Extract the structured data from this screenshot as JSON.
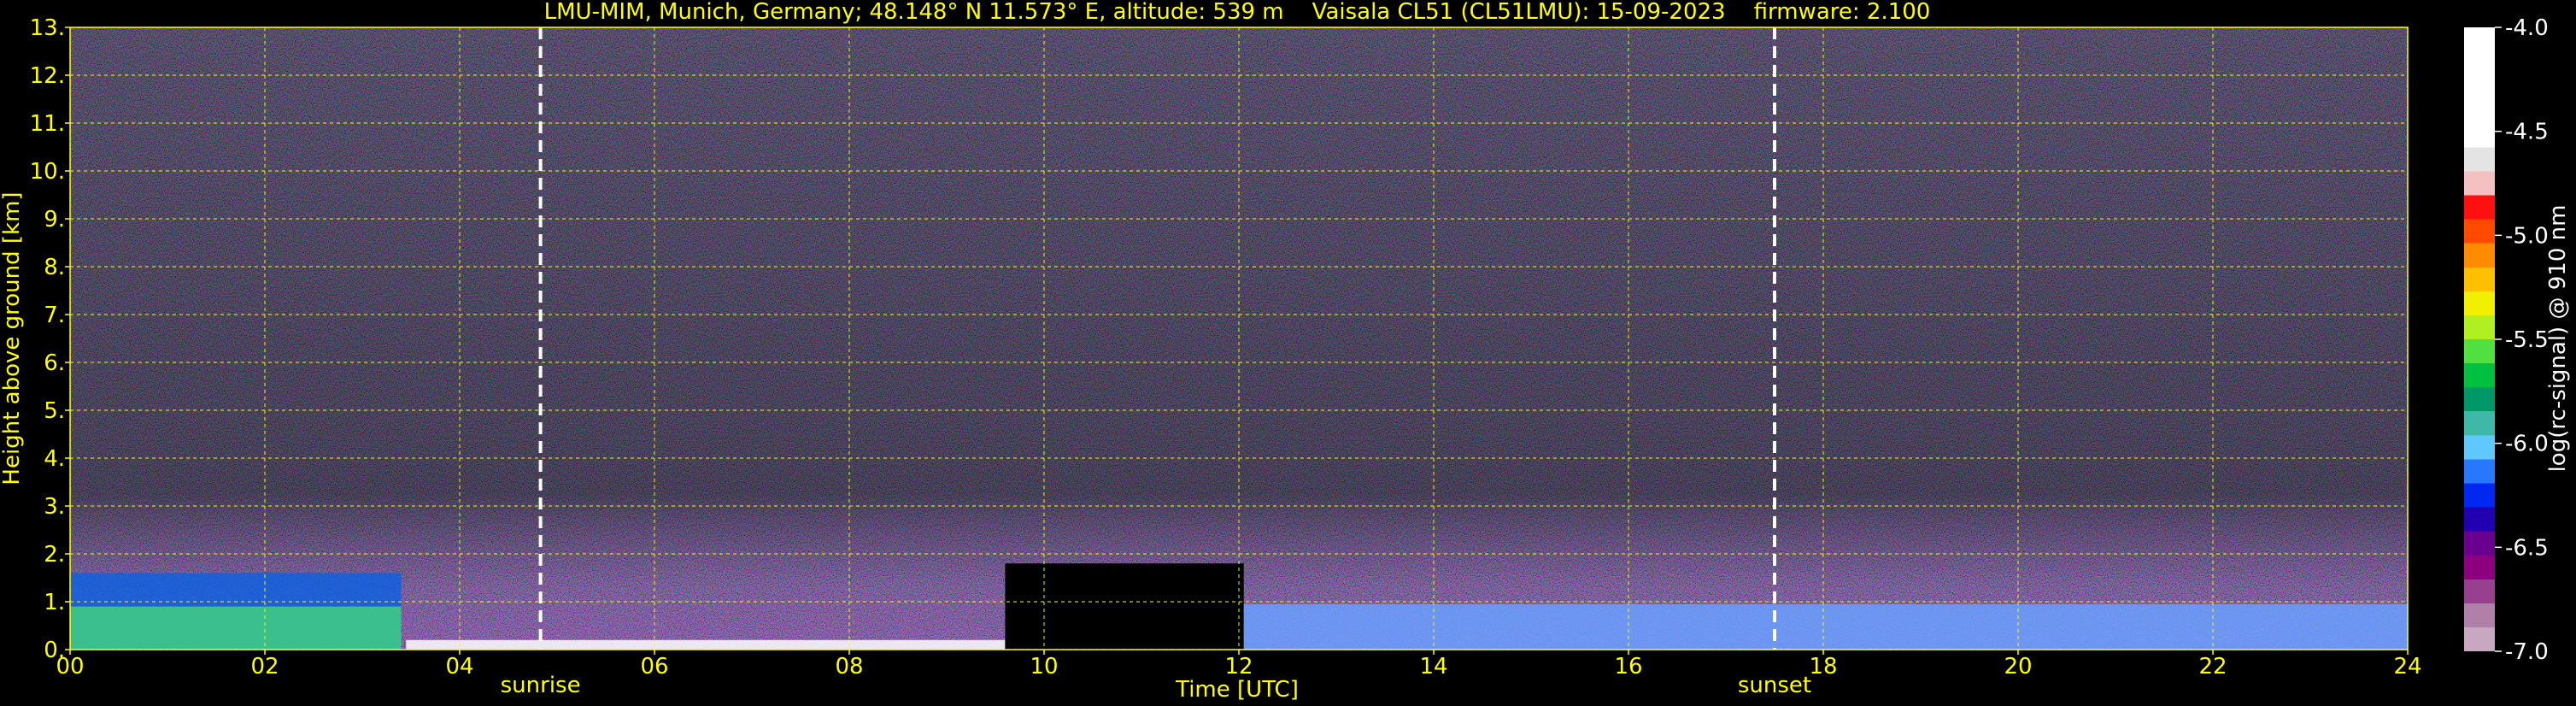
{
  "header": {
    "title": "LMU-MIM, Munich, Germany; 48.148° N 11.573° E, altitude: 539 m    Vaisala CL51 (CL51LMU): 15-09-2023    firmware: 2.100"
  },
  "chart_data": {
    "type": "heatmap",
    "title": "LMU-MIM, Munich, Germany; 48.148° N 11.573° E, altitude: 539 m    Vaisala CL51 (CL51LMU): 15-09-2023    firmware: 2.100",
    "xlabel": "Time [UTC]",
    "ylabel": "Height above ground [km]",
    "xlim": [
      0,
      24
    ],
    "ylim": [
      0,
      13
    ],
    "x_ticks": [
      "00",
      "02",
      "04",
      "06",
      "08",
      "10",
      "12",
      "14",
      "16",
      "18",
      "20",
      "22",
      "24"
    ],
    "x_tick_values": [
      0,
      2,
      4,
      6,
      8,
      10,
      12,
      14,
      16,
      18,
      20,
      22,
      24
    ],
    "y_ticks": [
      "0.",
      "1.",
      "2.",
      "3.",
      "4.",
      "5.",
      "6.",
      "7.",
      "8.",
      "9.",
      "10.",
      "11.",
      "12.",
      "13."
    ],
    "y_tick_values": [
      0,
      1,
      2,
      3,
      4,
      5,
      6,
      7,
      8,
      9,
      10,
      11,
      12,
      13
    ],
    "grid": true,
    "markers": [
      {
        "label": "sunrise",
        "x": 4.83
      },
      {
        "label": "sunset",
        "x": 17.5
      }
    ],
    "colorbar": {
      "label": "log(rc-signal) @ 910 nm",
      "range": [
        -7.0,
        -4.0
      ],
      "ticks": [
        "-4.0",
        "-4.5",
        "-5.0",
        "-5.5",
        "-6.0",
        "-6.5",
        "-7.0"
      ],
      "tick_values": [
        -4.0,
        -4.5,
        -5.0,
        -5.5,
        -6.0,
        -6.5,
        -7.0
      ],
      "colors": [
        "#ffffff",
        "#ffffff",
        "#ffffff",
        "#ffffff",
        "#ffffff",
        "#e4e4e4",
        "#f4c0c0",
        "#ff1010",
        "#ff4a00",
        "#ff8c00",
        "#ffc000",
        "#f0f000",
        "#b0f020",
        "#50e040",
        "#00c040",
        "#009868",
        "#40b8a8",
        "#60c8ff",
        "#2878ff",
        "#0028f0",
        "#2000b0",
        "#6a0090",
        "#8c0080",
        "#984090",
        "#b080a8",
        "#c8a8c0"
      ]
    },
    "layers": [
      {
        "x_range": [
          0,
          3.4
        ],
        "height_top": 1.6,
        "description_color": "#1060e0"
      },
      {
        "x_range": [
          0,
          3.4
        ],
        "height_top": 0.9,
        "description_color": "#40d080"
      },
      {
        "x_range": [
          3.45,
          9.6
        ],
        "height_top": 0.2,
        "description_color": "#ffffff"
      },
      {
        "x_range": [
          9.6,
          12.05
        ],
        "height_top": 1.8,
        "description_color": "#000000"
      },
      {
        "x_range": [
          12.05,
          24
        ],
        "height_top": 0.95,
        "description_color": "#6aa0ff"
      }
    ],
    "colors": {
      "text": "#ffff00",
      "grid": "#ffff00",
      "background": "#000000",
      "marker": "#ffffff"
    }
  }
}
